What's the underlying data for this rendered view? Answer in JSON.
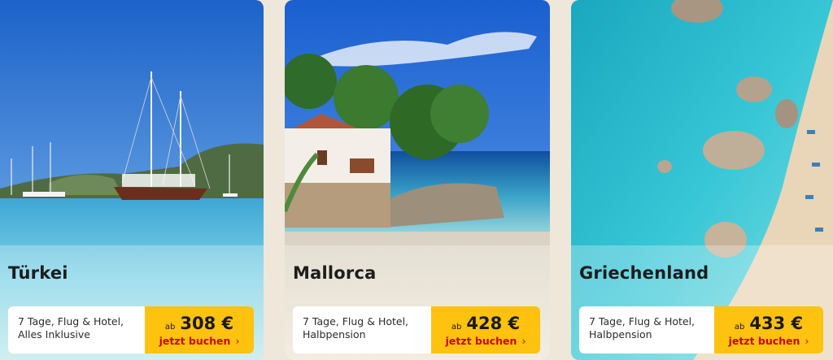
{
  "offers": [
    {
      "destination": "Türkei",
      "description_line1": "7 Tage, Flug & Hotel,",
      "description_line2": "Alles Inklusive",
      "price_prefix": "ab",
      "price": "308 €",
      "cta": "jetzt buchen",
      "chevron": "›"
    },
    {
      "destination": "Mallorca",
      "description_line1": "7 Tage, Flug & Hotel,",
      "description_line2": "Halbpension",
      "price_prefix": "ab",
      "price": "428 €",
      "cta": "jetzt buchen",
      "chevron": "›"
    },
    {
      "destination": "Griechenland",
      "description_line1": "7 Tage, Flug & Hotel,",
      "description_line2": "Halbpension",
      "price_prefix": "ab",
      "price": "433 €",
      "cta": "jetzt buchen",
      "chevron": "›"
    }
  ],
  "colors": {
    "cta_background": "#ffc20e",
    "cta_text": "#d1001c",
    "page_background": "#efe7da"
  }
}
